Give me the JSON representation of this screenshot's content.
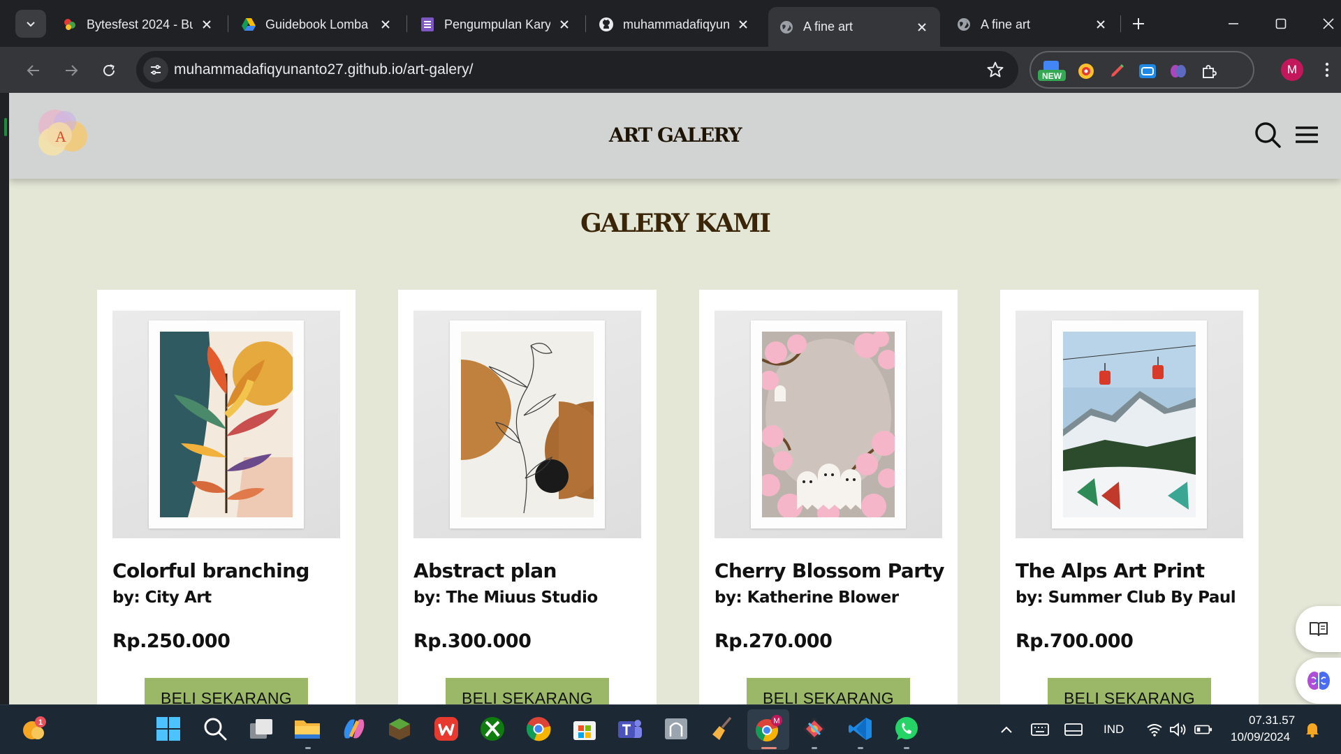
{
  "browser": {
    "tabs": [
      {
        "title": "Bytesfest 2024 - Bu",
        "icon": "bytesfest-icon",
        "active": false
      },
      {
        "title": "Guidebook Lomba",
        "icon": "google-drive-icon",
        "active": false
      },
      {
        "title": "Pengumpulan Kary",
        "icon": "google-forms-icon",
        "active": false
      },
      {
        "title": "muhammadafiqyun",
        "icon": "github-icon",
        "active": false
      },
      {
        "title": "A fine art",
        "icon": "globe-icon",
        "active": true
      },
      {
        "title": "A fine art",
        "icon": "globe-icon",
        "active": false
      }
    ],
    "url": "muhammadafiqyunanto27.github.io/art-galery/",
    "extension_new_badge": "NEW",
    "profile_initial": "M"
  },
  "site": {
    "logo_letter": "A",
    "title": "ART GALERY",
    "section_title": "GALERY KAMI",
    "artworks": [
      {
        "name": "Colorful branching",
        "artist": "by: City Art",
        "price": "Rp.250.000",
        "button": "BELI SEKARANG"
      },
      {
        "name": "Abstract plan",
        "artist": "by: The Miuus Studio",
        "price": "Rp.300.000",
        "button": "BELI SEKARANG"
      },
      {
        "name": "Cherry Blossom Party",
        "artist": "by: Katherine Blower",
        "price": "Rp.270.000",
        "button": "BELI SEKARANG"
      },
      {
        "name": "The Alps Art Print",
        "artist": "by: Summer Club By Paul",
        "price": "Rp.700.000",
        "button": "BELI SEKARANG"
      }
    ]
  },
  "taskbar": {
    "weather_badge": "1",
    "chrome_badge": "M",
    "language": "IND",
    "time": "07.31.57",
    "date": "10/09/2024"
  },
  "colors": {
    "page_background": "#e4e7d6",
    "header_background": "#d2d3d3",
    "button_green": "#9ab868",
    "title_brown": "#3a2508"
  }
}
